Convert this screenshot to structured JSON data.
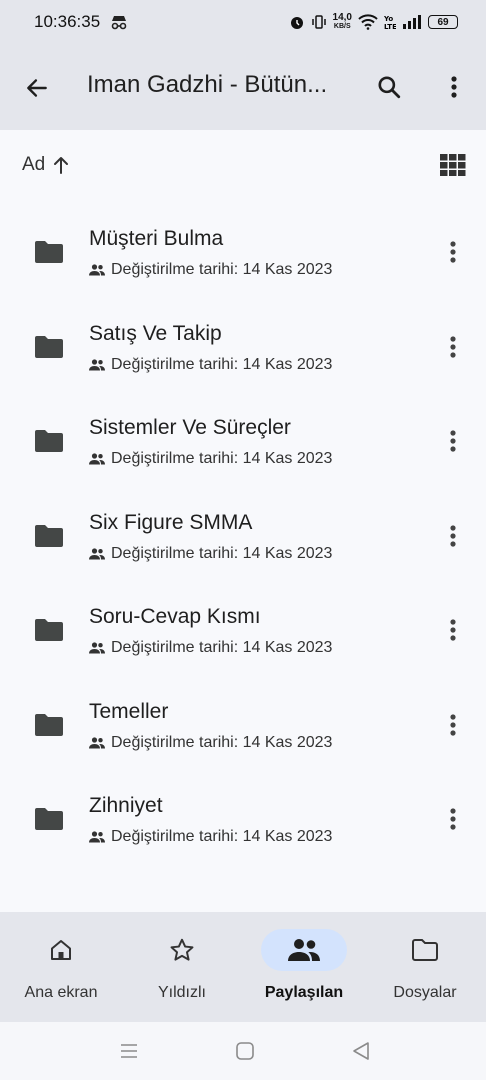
{
  "status_bar": {
    "time": "10:36:35",
    "net_speed": "14,0",
    "net_unit": "KB/S",
    "battery": "69"
  },
  "app_bar": {
    "title": "Iman Gadzhi -  Bütün...",
    "icons": [
      "arrow-back-icon",
      "search-icon",
      "more-vert-icon"
    ]
  },
  "sort": {
    "label": "Ad",
    "direction_icon": "arrow-up-icon",
    "view_icon": "grid-view-icon"
  },
  "folders": [
    {
      "name": "Müşteri Bulma",
      "meta": "Değiştirilme tarihi: 14 Kas 2023"
    },
    {
      "name": "Satış Ve Takip",
      "meta": "Değiştirilme tarihi: 14 Kas 2023"
    },
    {
      "name": "Sistemler Ve Süreçler",
      "meta": "Değiştirilme tarihi: 14 Kas 2023"
    },
    {
      "name": "Six Figure SMMA",
      "meta": "Değiştirilme tarihi: 14 Kas 2023"
    },
    {
      "name": "Soru-Cevap Kısmı",
      "meta": "Değiştirilme tarihi: 14 Kas 2023"
    },
    {
      "name": "Temeller",
      "meta": "Değiştirilme tarihi: 14 Kas 2023"
    },
    {
      "name": "Zihniyet",
      "meta": "Değiştirilme tarihi: 14 Kas 2023"
    }
  ],
  "bottom_nav": [
    {
      "label": "Ana ekran",
      "icon": "home-icon",
      "active": false
    },
    {
      "label": "Yıldızlı",
      "icon": "star-icon",
      "active": false
    },
    {
      "label": "Paylaşılan",
      "icon": "people-icon",
      "active": true
    },
    {
      "label": "Dosyalar",
      "icon": "folder-icon",
      "active": false
    }
  ],
  "colors": {
    "bar_bg": "#e4e6ec",
    "page_bg": "#f8f9fc",
    "active_pill": "#d3e3fd"
  }
}
